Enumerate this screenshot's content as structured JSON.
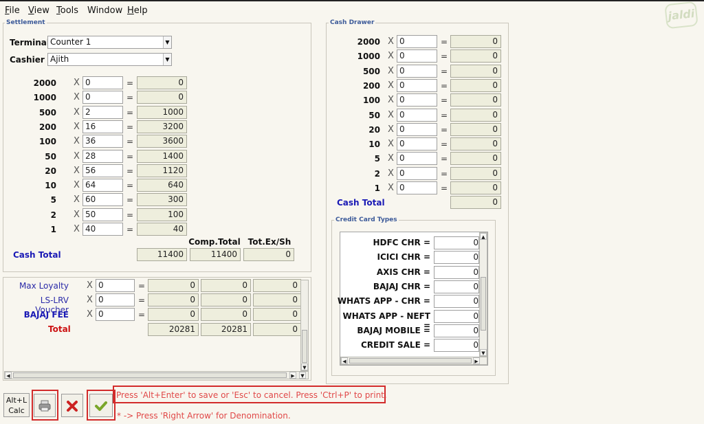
{
  "menu": [
    {
      "label": "File",
      "mnemonic": "F",
      "rest": "ile"
    },
    {
      "label": "View",
      "mnemonic": "V",
      "rest": "iew"
    },
    {
      "label": "Tools",
      "mnemonic": "T",
      "rest": "ools"
    },
    {
      "label": "Window",
      "mnemonic": "",
      "rest": "Window"
    },
    {
      "label": "Help",
      "mnemonic": "H",
      "rest": "elp"
    }
  ],
  "logo_text": "jaldi",
  "settlement": {
    "title": "Settlement",
    "terminal_label": "Terminal",
    "terminal_value": "Counter 1",
    "cashier_label": "Cashier",
    "cashier_value": "Ajith",
    "rows": [
      {
        "denom": "2000",
        "qty": "0",
        "amount": "0"
      },
      {
        "denom": "1000",
        "qty": "0",
        "amount": "0"
      },
      {
        "denom": "500",
        "qty": "2",
        "amount": "1000"
      },
      {
        "denom": "200",
        "qty": "16",
        "amount": "3200"
      },
      {
        "denom": "100",
        "qty": "36",
        "amount": "3600"
      },
      {
        "denom": "50",
        "qty": "28",
        "amount": "1400"
      },
      {
        "denom": "20",
        "qty": "56",
        "amount": "1120"
      },
      {
        "denom": "10",
        "qty": "64",
        "amount": "640"
      },
      {
        "denom": "5",
        "qty": "60",
        "amount": "300"
      },
      {
        "denom": "2",
        "qty": "50",
        "amount": "100"
      },
      {
        "denom": "1",
        "qty": "40",
        "amount": "40"
      }
    ],
    "comp_total_header": "Comp.Total",
    "tot_ex_header": "Tot.Ex/Sh",
    "cash_total_label": "Cash Total",
    "cash_total": "11400",
    "comp_total": "11400",
    "tot_ex": "0"
  },
  "others": {
    "rows": [
      {
        "label": "Max Loyalty",
        "qty": "0",
        "amount": "0",
        "comp": "0",
        "ex": "0"
      },
      {
        "label": "LS-LRV Voucher",
        "qty": "0",
        "amount": "0",
        "comp": "0",
        "ex": "0"
      },
      {
        "label": "BAJAJ FEE",
        "qty": "0",
        "amount": "0",
        "comp": "0",
        "ex": "0"
      }
    ],
    "total_label": "Total",
    "total_amount": "20281",
    "total_comp": "20281",
    "total_ex": "0"
  },
  "cash_drawer": {
    "title": "Cash Drawer",
    "rows": [
      {
        "denom": "2000",
        "qty": "0",
        "amount": "0"
      },
      {
        "denom": "1000",
        "qty": "0",
        "amount": "0"
      },
      {
        "denom": "500",
        "qty": "0",
        "amount": "0"
      },
      {
        "denom": "200",
        "qty": "0",
        "amount": "0"
      },
      {
        "denom": "100",
        "qty": "0",
        "amount": "0"
      },
      {
        "denom": "50",
        "qty": "0",
        "amount": "0"
      },
      {
        "denom": "20",
        "qty": "0",
        "amount": "0"
      },
      {
        "denom": "10",
        "qty": "0",
        "amount": "0"
      },
      {
        "denom": "5",
        "qty": "0",
        "amount": "0"
      },
      {
        "denom": "2",
        "qty": "0",
        "amount": "0"
      },
      {
        "denom": "1",
        "qty": "0",
        "amount": "0"
      }
    ],
    "cash_total_label": "Cash Total",
    "cash_total": "0"
  },
  "credit_cards": {
    "title": "Credit Card Types",
    "rows": [
      {
        "label": "HDFC CHR =",
        "value": "0"
      },
      {
        "label": "ICICI CHR =",
        "value": "0"
      },
      {
        "label": "AXIS CHR =",
        "value": "0"
      },
      {
        "label": "BAJAJ CHR =",
        "value": "0"
      },
      {
        "label": "WHATS APP - CHR =",
        "value": "0"
      },
      {
        "label": "WHATS APP - NEFT =",
        "value": "0"
      },
      {
        "label": "BAJAJ MOBILE =",
        "value": "0"
      },
      {
        "label": "CREDIT SALE =",
        "value": "0"
      }
    ]
  },
  "buttons": {
    "calc_line1": "Alt+L",
    "calc_line2": "Calc"
  },
  "hints": {
    "save": "Press 'Alt+Enter' to save or 'Esc' to cancel. Press 'Ctrl+P' to print.",
    "denomination": "* -> Press 'Right Arrow' for Denomination."
  },
  "colors": {
    "accent_blue": "#1a1ab5",
    "total_red": "#cc1111",
    "hint_red": "#e04848",
    "readonly_bg": "#eeeedd"
  }
}
